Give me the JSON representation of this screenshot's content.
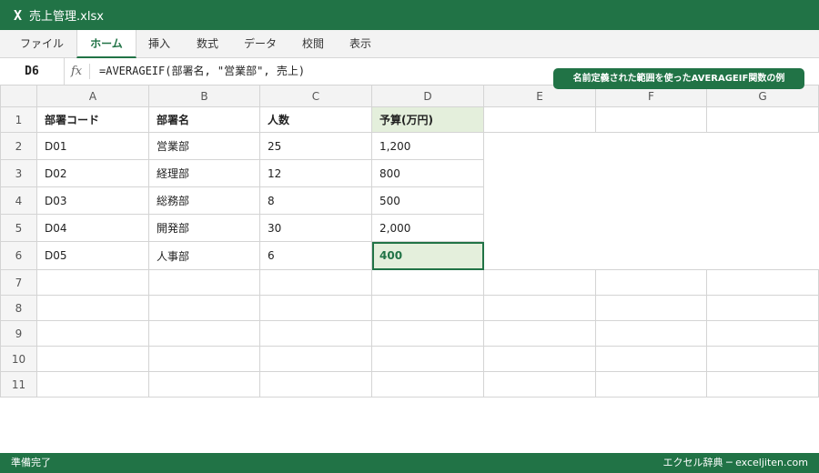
{
  "window": {
    "app_logo": "X",
    "file_name": "売上管理.xlsx"
  },
  "ribbon": {
    "tabs": [
      {
        "label": "ファイル",
        "active": false
      },
      {
        "label": "ホーム",
        "active": true
      },
      {
        "label": "挿入",
        "active": false
      },
      {
        "label": "数式",
        "active": false
      },
      {
        "label": "データ",
        "active": false
      },
      {
        "label": "校閲",
        "active": false
      },
      {
        "label": "表示",
        "active": false
      }
    ]
  },
  "formula_bar": {
    "name_box": "D6",
    "fx_label": "fx",
    "formula": "=AVERAGEIF(部署名, \"営業部\", 売上)"
  },
  "callout": "名前定義された範囲を使ったAVERAGEIF関数の例",
  "sheet": {
    "columns": [
      "A",
      "B",
      "C",
      "D",
      "E",
      "F",
      "G"
    ],
    "row_numbers": [
      "1",
      "2",
      "3",
      "4",
      "5",
      "6",
      "7",
      "8",
      "9",
      "10",
      "11"
    ],
    "headers": [
      "部署コード",
      "部署名",
      "人数",
      "予算(万円)"
    ],
    "rows": [
      [
        "D01",
        "営業部",
        "25",
        "1,200"
      ],
      [
        "D02",
        "経理部",
        "12",
        "800"
      ],
      [
        "D03",
        "総務部",
        "8",
        "500"
      ],
      [
        "D04",
        "開発部",
        "30",
        "2,000"
      ],
      [
        "D05",
        "人事部",
        "6",
        "400"
      ]
    ],
    "selected_cell": "D6"
  },
  "status": {
    "left": "準備完了",
    "right": "エクセル辞典 ─ exceljiten.com"
  },
  "colors": {
    "accent": "#217346",
    "selected_fill": "#e4efdc"
  }
}
